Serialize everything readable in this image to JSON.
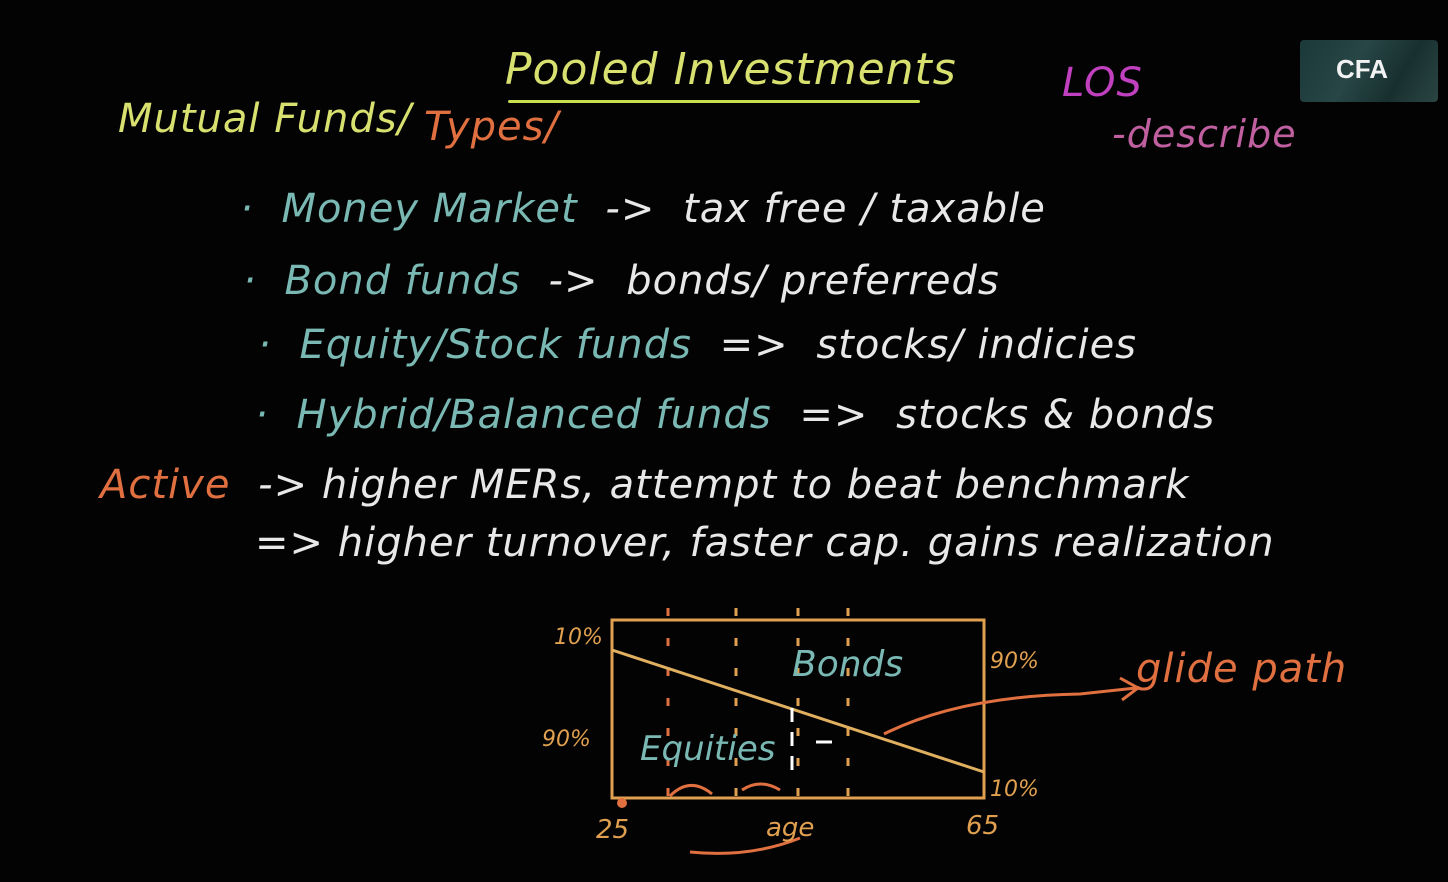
{
  "title": "Pooled Investments",
  "los": {
    "label": "LOS",
    "describe": "-describe"
  },
  "logo": {
    "text": "CFA"
  },
  "left_header": {
    "mutual": "Mutual Funds/",
    "types": "Types/"
  },
  "fund_types": [
    {
      "bullet": "·",
      "name": "Money Market",
      "arrow": "->",
      "desc": "tax free / taxable"
    },
    {
      "bullet": "·",
      "name": "Bond funds",
      "arrow": "->",
      "desc": "bonds/ preferreds"
    },
    {
      "bullet": "·",
      "name": "Equity/Stock funds",
      "arrow": "=>",
      "desc": "stocks/ indicies"
    },
    {
      "bullet": "·",
      "name": "Hybrid/Balanced funds",
      "arrow": "=>",
      "desc": "stocks & bonds"
    }
  ],
  "active": {
    "label": "Active",
    "line1": "-> higher MERs, attempt to beat benchmark",
    "line2": "=> higher turnover, faster cap. gains realization"
  },
  "diagram": {
    "top_left_pct": "10%",
    "mid_left_pct": "90%",
    "top_right_pct": "90%",
    "bottom_right_pct": "10%",
    "x_start": "25",
    "x_end": "65",
    "x_label": "age",
    "upper_region": "Bonds",
    "lower_region": "Equities",
    "annotation": "glide path"
  },
  "colors": {
    "background": "#030303",
    "title": "#d8e070",
    "teal": "#7ab8b4",
    "orange": "#e07040",
    "box": "#e0a050"
  }
}
